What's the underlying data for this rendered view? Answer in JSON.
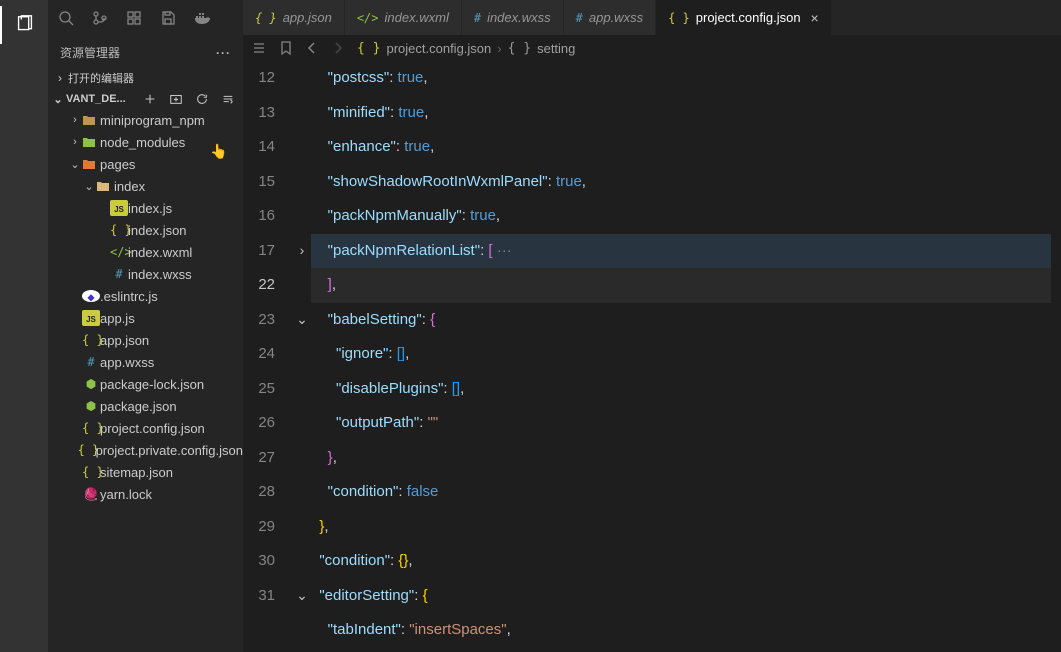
{
  "activityBar": {
    "active": "explorer"
  },
  "sidebar": {
    "title": "资源管理器",
    "openEditorsLabel": "打开的编辑器",
    "folderName": "VANT_DE...",
    "actions": {
      "newFile": "+",
      "newFolder": "⊞",
      "refresh": "⟳",
      "collapse": "⇥"
    }
  },
  "tree": [
    {
      "depth": 1,
      "kind": "folder-closed",
      "icon": "ic-folder",
      "label": "miniprogram_npm",
      "chev": "›"
    },
    {
      "depth": 1,
      "kind": "folder-closed",
      "icon": "ic-folder-green",
      "label": "node_modules",
      "chev": "›"
    },
    {
      "depth": 1,
      "kind": "folder-open",
      "icon": "ic-pages",
      "label": "pages",
      "chev": "⌄"
    },
    {
      "depth": 2,
      "kind": "folder-open",
      "icon": "ic-folder-open",
      "label": "index",
      "chev": "⌄"
    },
    {
      "depth": 3,
      "kind": "file",
      "icon": "ic-js",
      "iconText": "JS",
      "label": "index.js"
    },
    {
      "depth": 3,
      "kind": "file",
      "icon": "ic-json",
      "iconText": "{ }",
      "label": "index.json"
    },
    {
      "depth": 3,
      "kind": "file",
      "icon": "ic-wxml",
      "iconText": "</>",
      "label": "index.wxml"
    },
    {
      "depth": 3,
      "kind": "file",
      "icon": "ic-wxss",
      "iconText": "#",
      "label": "index.wxss"
    },
    {
      "depth": 1,
      "kind": "file",
      "icon": "ic-eslint",
      "iconText": "◆",
      "label": ".eslintrc.js"
    },
    {
      "depth": 1,
      "kind": "file",
      "icon": "ic-js",
      "iconText": "JS",
      "label": "app.js"
    },
    {
      "depth": 1,
      "kind": "file",
      "icon": "ic-json",
      "iconText": "{ }",
      "label": "app.json"
    },
    {
      "depth": 1,
      "kind": "file",
      "icon": "ic-wxss",
      "iconText": "#",
      "label": "app.wxss"
    },
    {
      "depth": 1,
      "kind": "file",
      "icon": "ic-node",
      "iconText": "⬢",
      "label": "package-lock.json"
    },
    {
      "depth": 1,
      "kind": "file",
      "icon": "ic-node",
      "iconText": "⬢",
      "label": "package.json"
    },
    {
      "depth": 1,
      "kind": "file",
      "icon": "ic-json",
      "iconText": "{ }",
      "label": "project.config.json"
    },
    {
      "depth": 1,
      "kind": "file",
      "icon": "ic-json",
      "iconText": "{ }",
      "label": "project.private.config.json"
    },
    {
      "depth": 1,
      "kind": "file",
      "icon": "ic-json",
      "iconText": "{ }",
      "label": "sitemap.json"
    },
    {
      "depth": 1,
      "kind": "file",
      "icon": "ic-yarn",
      "iconText": "🧶",
      "label": "yarn.lock"
    }
  ],
  "tabs": [
    {
      "icon": "ic-json",
      "iconText": "{ }",
      "label": "app.json",
      "active": false
    },
    {
      "icon": "ic-wxml",
      "iconText": "</>",
      "label": "index.wxml",
      "active": false
    },
    {
      "icon": "ic-wxss",
      "iconText": "#",
      "label": "index.wxss",
      "active": false
    },
    {
      "icon": "ic-wxss",
      "iconText": "#",
      "label": "app.wxss",
      "active": false
    },
    {
      "icon": "ic-json",
      "iconText": "{ }",
      "label": "project.config.json",
      "active": true
    }
  ],
  "breadcrumb": {
    "file": "project.config.json",
    "symbol": "setting",
    "fileIconText": "{ }",
    "symbolIconText": "{ }"
  },
  "gutter": {
    "lines": [
      "12",
      "13",
      "14",
      "15",
      "16",
      "17",
      "22",
      "23",
      "24",
      "25",
      "26",
      "27",
      "28",
      "29",
      "30",
      "31",
      ""
    ],
    "currentIndex": 6,
    "folds": [
      {
        "index": 5,
        "glyph": "›"
      },
      {
        "index": 7,
        "glyph": "⌄"
      },
      {
        "index": 15,
        "glyph": "⌄"
      }
    ]
  },
  "code": [
    {
      "indent": 4,
      "tokens": [
        [
          "tok-key",
          "\"postcss\""
        ],
        [
          "tok-punc",
          ": "
        ],
        [
          "tok-bool",
          "true"
        ],
        [
          "tok-punc",
          ","
        ]
      ]
    },
    {
      "indent": 4,
      "tokens": [
        [
          "tok-key",
          "\"minified\""
        ],
        [
          "tok-punc",
          ": "
        ],
        [
          "tok-bool",
          "true"
        ],
        [
          "tok-punc",
          ","
        ]
      ]
    },
    {
      "indent": 4,
      "tokens": [
        [
          "tok-key",
          "\"enhance\""
        ],
        [
          "tok-punc",
          ": "
        ],
        [
          "tok-bool",
          "true"
        ],
        [
          "tok-punc",
          ","
        ]
      ]
    },
    {
      "indent": 4,
      "tokens": [
        [
          "tok-key",
          "\"showShadowRootInWxmlPanel\""
        ],
        [
          "tok-punc",
          ": "
        ],
        [
          "tok-bool",
          "true"
        ],
        [
          "tok-punc",
          ","
        ]
      ]
    },
    {
      "indent": 4,
      "tokens": [
        [
          "tok-key",
          "\"packNpmManually\""
        ],
        [
          "tok-punc",
          ": "
        ],
        [
          "tok-bool",
          "true"
        ],
        [
          "tok-punc",
          ","
        ]
      ]
    },
    {
      "indent": 4,
      "hl": true,
      "tokens": [
        [
          "tok-key",
          "\"packNpmRelationList\""
        ],
        [
          "tok-punc",
          ": "
        ],
        [
          "tok-brace2",
          "["
        ],
        [
          "tok-fold",
          " ···"
        ]
      ]
    },
    {
      "indent": 4,
      "hl": true,
      "current": true,
      "tokens": [
        [
          "tok-brace2",
          "]"
        ],
        [
          "tok-punc",
          ","
        ]
      ]
    },
    {
      "indent": 4,
      "tokens": [
        [
          "tok-key",
          "\"babelSetting\""
        ],
        [
          "tok-punc",
          ": "
        ],
        [
          "tok-brace2",
          "{"
        ]
      ]
    },
    {
      "indent": 6,
      "tokens": [
        [
          "tok-key",
          "\"ignore\""
        ],
        [
          "tok-punc",
          ": "
        ],
        [
          "tok-brace3",
          "["
        ],
        [
          "tok-brace3",
          "]"
        ],
        [
          "tok-punc",
          ","
        ]
      ]
    },
    {
      "indent": 6,
      "tokens": [
        [
          "tok-key",
          "\"disablePlugins\""
        ],
        [
          "tok-punc",
          ": "
        ],
        [
          "tok-brace3",
          "["
        ],
        [
          "tok-brace3",
          "]"
        ],
        [
          "tok-punc",
          ","
        ]
      ]
    },
    {
      "indent": 6,
      "tokens": [
        [
          "tok-key",
          "\"outputPath\""
        ],
        [
          "tok-punc",
          ": "
        ],
        [
          "tok-str",
          "\"\""
        ]
      ]
    },
    {
      "indent": 4,
      "tokens": [
        [
          "tok-brace2",
          "}"
        ],
        [
          "tok-punc",
          ","
        ]
      ]
    },
    {
      "indent": 4,
      "tokens": [
        [
          "tok-key",
          "\"condition\""
        ],
        [
          "tok-punc",
          ": "
        ],
        [
          "tok-bool",
          "false"
        ]
      ]
    },
    {
      "indent": 2,
      "tokens": [
        [
          "tok-brace",
          "}"
        ],
        [
          "tok-punc",
          ","
        ]
      ]
    },
    {
      "indent": 2,
      "tokens": [
        [
          "tok-key",
          "\"condition\""
        ],
        [
          "tok-punc",
          ": "
        ],
        [
          "tok-brace",
          "{"
        ],
        [
          "tok-brace",
          "}"
        ],
        [
          "tok-punc",
          ","
        ]
      ]
    },
    {
      "indent": 2,
      "tokens": [
        [
          "tok-key",
          "\"editorSetting\""
        ],
        [
          "tok-punc",
          ": "
        ],
        [
          "tok-brace",
          "{"
        ]
      ]
    },
    {
      "indent": 4,
      "tokens": [
        [
          "tok-key",
          "\"tabIndent\""
        ],
        [
          "tok-punc",
          ": "
        ],
        [
          "tok-str",
          "\"insertSpaces\""
        ],
        [
          "tok-punc",
          ","
        ]
      ]
    }
  ]
}
